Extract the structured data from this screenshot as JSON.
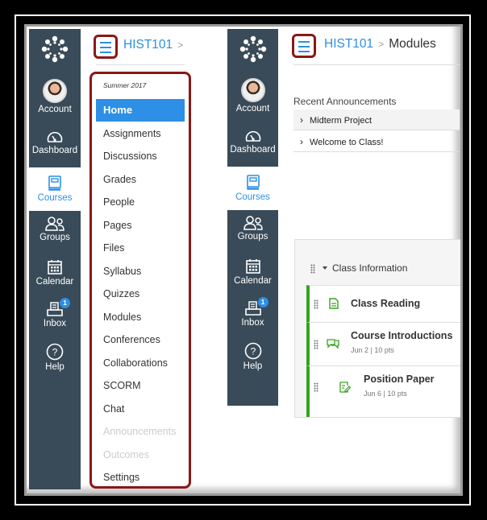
{
  "global_nav": {
    "items": [
      {
        "id": "account",
        "label": "Account",
        "icon": "avatar"
      },
      {
        "id": "dashboard",
        "label": "Dashboard",
        "icon": "dashboard-icon"
      },
      {
        "id": "courses",
        "label": "Courses",
        "icon": "courses-icon",
        "active": true
      },
      {
        "id": "groups",
        "label": "Groups",
        "icon": "groups-icon"
      },
      {
        "id": "calendar",
        "label": "Calendar",
        "icon": "calendar-icon"
      },
      {
        "id": "inbox",
        "label": "Inbox",
        "icon": "inbox-icon",
        "badge": "1"
      },
      {
        "id": "help",
        "label": "Help",
        "icon": "help-icon"
      }
    ]
  },
  "left_panel": {
    "breadcrumb": {
      "course": "HIST101",
      "separator": ">"
    },
    "term": "Summer 2017",
    "course_menu": [
      {
        "label": "Home",
        "state": "active"
      },
      {
        "label": "Assignments",
        "state": "normal"
      },
      {
        "label": "Discussions",
        "state": "normal"
      },
      {
        "label": "Grades",
        "state": "normal"
      },
      {
        "label": "People",
        "state": "normal"
      },
      {
        "label": "Pages",
        "state": "normal"
      },
      {
        "label": "Files",
        "state": "normal"
      },
      {
        "label": "Syllabus",
        "state": "normal"
      },
      {
        "label": "Quizzes",
        "state": "normal"
      },
      {
        "label": "Modules",
        "state": "normal"
      },
      {
        "label": "Conferences",
        "state": "normal"
      },
      {
        "label": "Collaborations",
        "state": "normal"
      },
      {
        "label": "SCORM",
        "state": "normal"
      },
      {
        "label": "Chat",
        "state": "normal"
      },
      {
        "label": "Announcements",
        "state": "disabled"
      },
      {
        "label": "Outcomes",
        "state": "disabled"
      },
      {
        "label": "Settings",
        "state": "normal"
      }
    ]
  },
  "right_panel": {
    "breadcrumb": {
      "course": "HIST101",
      "separator": ">",
      "current": "Modules"
    },
    "recent_announcements": {
      "title": "Recent Announcements",
      "items": [
        "Midterm Project",
        "Welcome to Class!"
      ]
    },
    "module": {
      "title": "Class Information",
      "items": [
        {
          "title": "Class Reading",
          "type": "page",
          "meta": ""
        },
        {
          "title": "Course Introductions",
          "type": "discussion",
          "meta": "Jun 2  |  10 pts"
        },
        {
          "title": "Position Paper",
          "type": "assignment",
          "meta": "Jun 6  |  10 pts"
        }
      ]
    }
  },
  "colors": {
    "nav_bg": "#394b58",
    "accent": "#2d8fe5",
    "highlight_border": "#8b1717",
    "module_green": "#38a21f"
  }
}
